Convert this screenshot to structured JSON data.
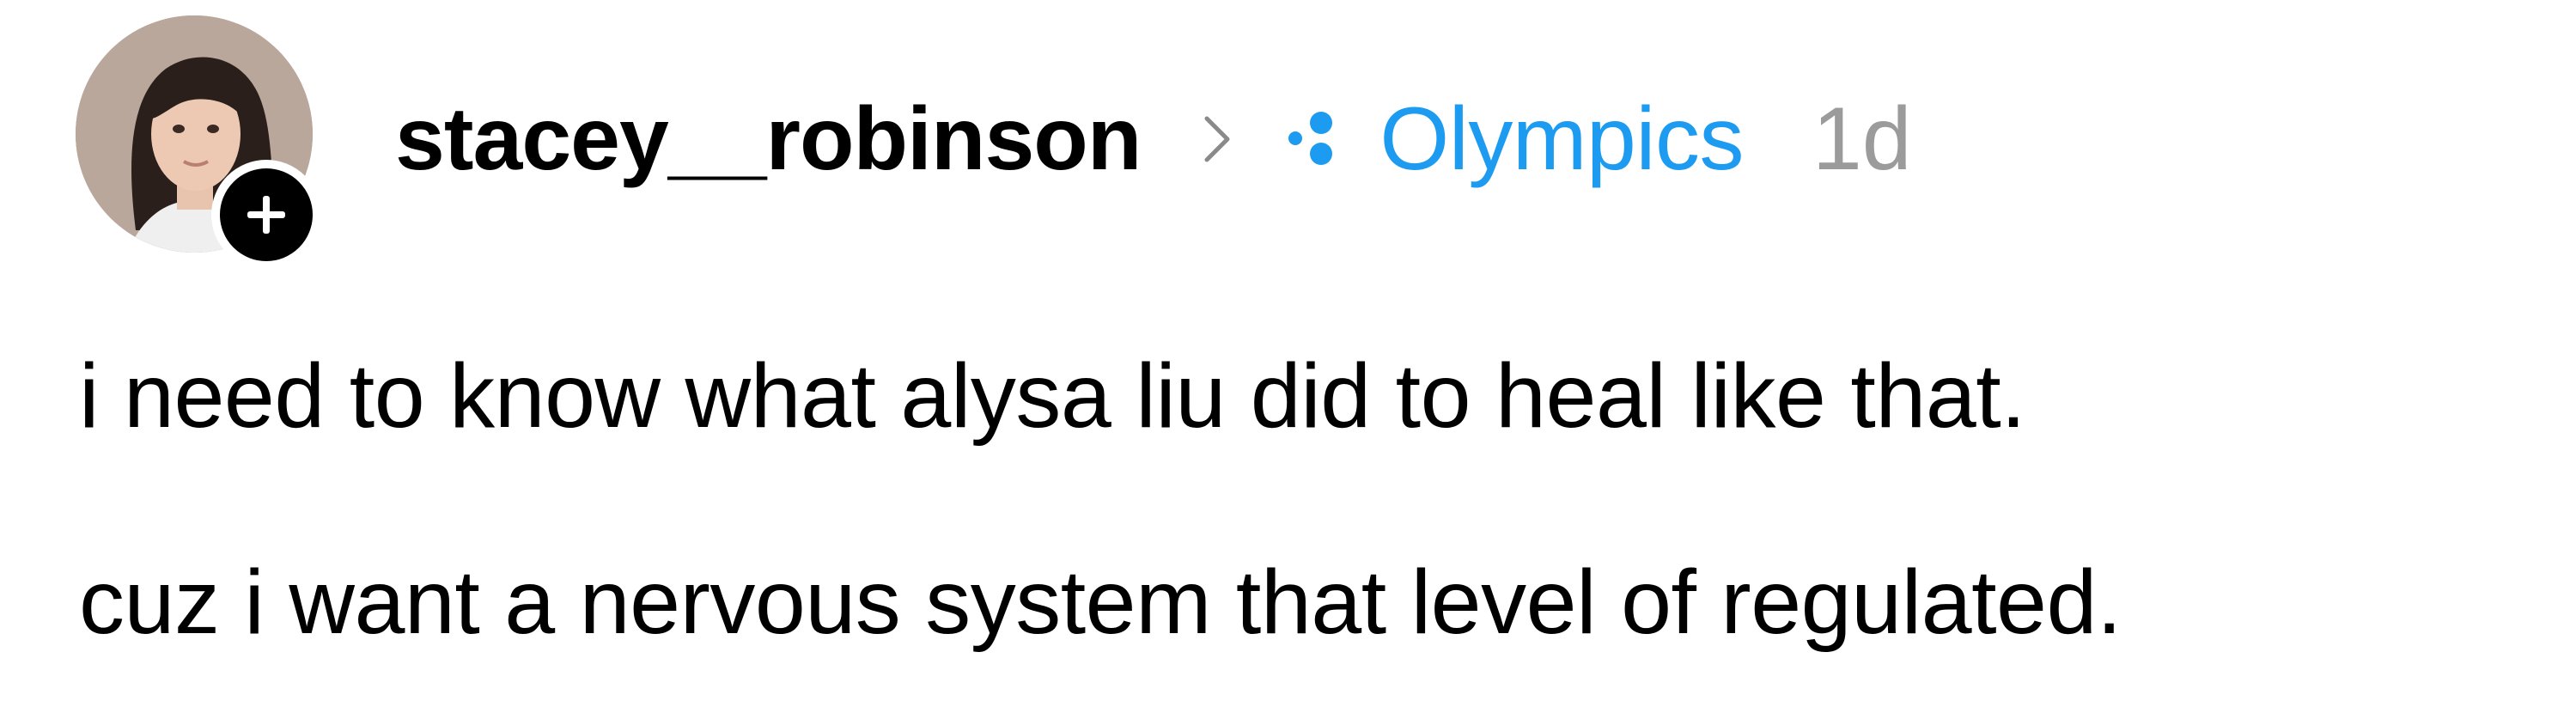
{
  "post": {
    "author": {
      "username": "stacey__robinson",
      "avatar_icon": "profile-photo",
      "follow_icon": "plus-icon"
    },
    "separator_icon": "chevron-right-icon",
    "community": {
      "name": "Olympics",
      "icon": "community-dots-icon",
      "color": "#1d9bf0"
    },
    "timestamp": "1d",
    "body": {
      "lines": [
        "i need to know what alysa liu did to heal like that.",
        "cuz i want a nervous system that level of regulated."
      ]
    }
  }
}
